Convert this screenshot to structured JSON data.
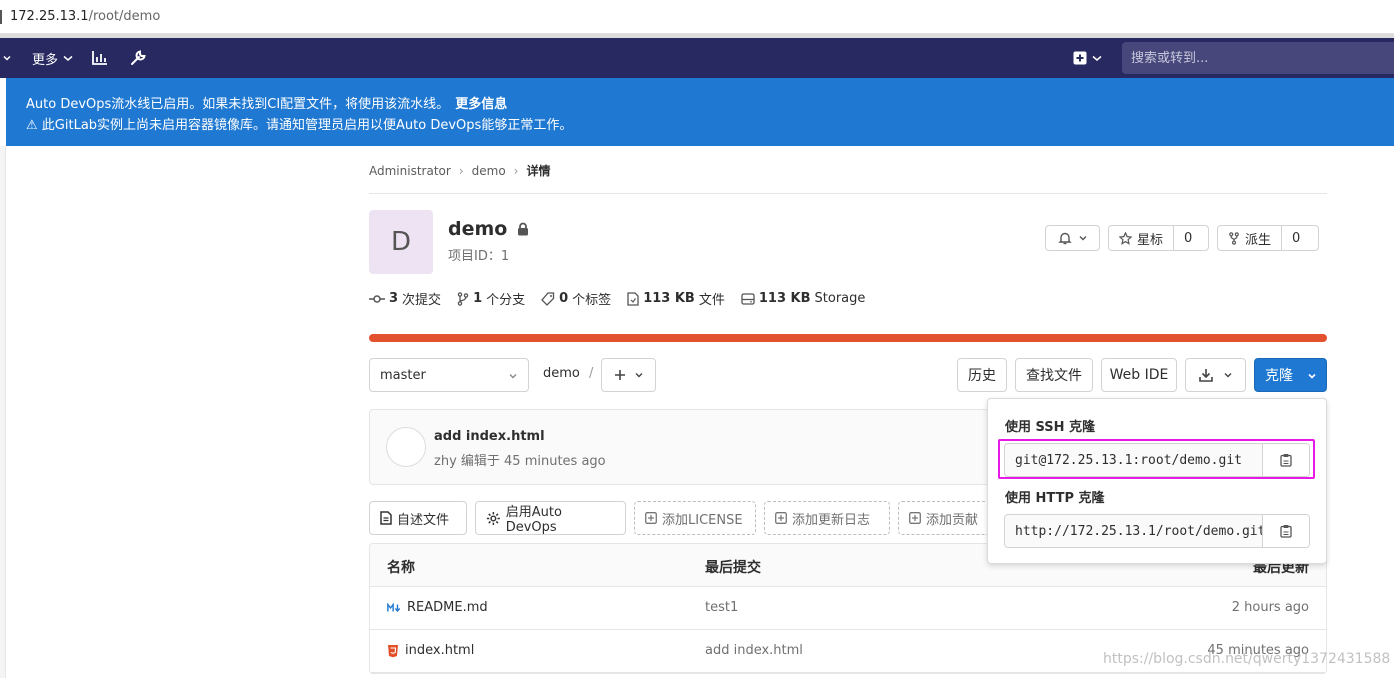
{
  "browser": {
    "url_host": "172.25.13.1",
    "url_path": "/root/demo"
  },
  "navbar": {
    "more_label": "更多",
    "search_placeholder": "搜索或转到..."
  },
  "banner": {
    "line1": "Auto DevOps流水线已启用。如果未找到CI配置文件，将使用该流水线。",
    "line1_link": "更多信息",
    "line2": "此GitLab实例上尚未启用容器镜像库。请通知管理员启用以便Auto DevOps能够正常工作。"
  },
  "breadcrumb": [
    "Administrator",
    "demo",
    "详情"
  ],
  "project": {
    "avatar_letter": "D",
    "name": "demo",
    "id_label": "项目ID：1",
    "star_label": "星标",
    "star_count": "0",
    "fork_label": "派生",
    "fork_count": "0"
  },
  "stats": {
    "commits_count": "3",
    "commits_label": "次提交",
    "branches_count": "1",
    "branches_label": "个分支",
    "tags_count": "0",
    "tags_label": "个标签",
    "files_size": "113 KB",
    "files_label": "文件",
    "storage_size": "113 KB",
    "storage_label": "Storage"
  },
  "toolbar": {
    "branch": "master",
    "path": "demo",
    "path_sep": "/",
    "history": "历史",
    "find_file": "查找文件",
    "web_ide": "Web IDE",
    "clone": "克隆"
  },
  "last_commit": {
    "message": "add index.html",
    "meta": "zhy 编辑于 45 minutes ago"
  },
  "quick_actions": [
    "自述文件",
    "启用Auto DevOps",
    "添加LICENSE",
    "添加更新日志",
    "添加贡献"
  ],
  "file_table": {
    "headers": {
      "name": "名称",
      "last_commit": "最后提交",
      "last_update": "最后更新"
    },
    "rows": [
      {
        "name": "README.md",
        "commit": "test1",
        "time": "2 hours ago"
      },
      {
        "name": "index.html",
        "commit": "add index.html",
        "time": "45 minutes ago"
      }
    ]
  },
  "clone_dropdown": {
    "ssh_label": "使用 SSH 克隆",
    "ssh_url": "git@172.25.13.1:root/demo.git",
    "http_label": "使用 HTTP 克隆",
    "http_url": "http://172.25.13.1/root/demo.git"
  },
  "watermark": "https://blog.csdn.net/qwerty1372431588",
  "colors": {
    "navbar": "#292961",
    "banner": "#1f78d1",
    "progress": "#e2522e",
    "primary": "#1f78d1",
    "highlight": "#e619e6"
  }
}
